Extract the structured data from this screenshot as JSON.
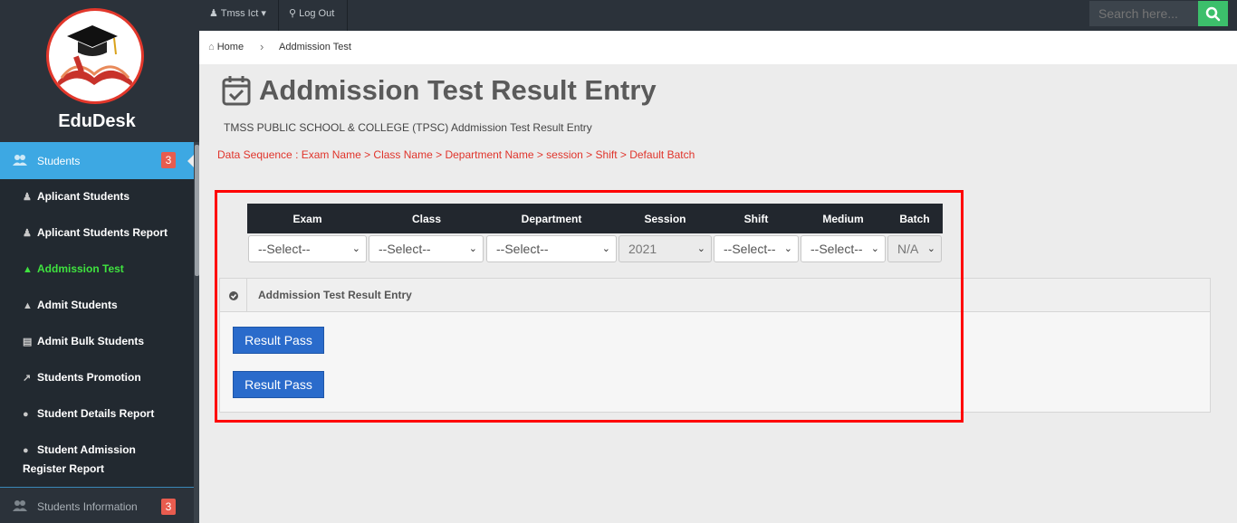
{
  "sidebar": {
    "brand": "EduDesk",
    "logo_icon": "graduation-book-logo",
    "active": {
      "label": "Students",
      "badge": "3",
      "icon": "users-icon"
    },
    "items": [
      {
        "label": "Aplicant Students",
        "icon": "user-add-icon",
        "green": false
      },
      {
        "label": "Aplicant Students Report",
        "icon": "user-add-icon",
        "green": false
      },
      {
        "label": "Addmission Test",
        "icon": "graduation-cap-icon",
        "green": true
      },
      {
        "label": "Admit Students",
        "icon": "graduation-cap-icon",
        "green": false
      },
      {
        "label": "Admit Bulk Students",
        "icon": "id-card-icon",
        "green": false
      },
      {
        "label": "Students Promotion",
        "icon": "line-chart-icon",
        "green": false
      },
      {
        "label": "Student Details Report",
        "icon": "circle-icon",
        "green": false
      },
      {
        "label": "Student Admission Register Report",
        "icon": "circle-icon",
        "green": false
      }
    ],
    "bottom": {
      "label": "Students Information",
      "badge": "3",
      "icon": "users-icon"
    }
  },
  "topbar": {
    "user": "Tmss Ict",
    "logout": "Log Out",
    "search_placeholder": "Search here..."
  },
  "breadcrumb": {
    "home": "Home",
    "current": "Addmission Test"
  },
  "page": {
    "title": "Addmission Test Result Entry",
    "subtitle": "TMSS PUBLIC SCHOOL & COLLEGE (TPSC) Addmission Test Result Entry",
    "sequence": "Data Sequence : Exam Name > Class Name > Department Name > session > Shift > Default Batch"
  },
  "filters": {
    "headers": {
      "exam": "Exam",
      "class": "Class",
      "department": "Department",
      "session": "Session",
      "shift": "Shift",
      "medium": "Medium",
      "batch": "Batch"
    },
    "values": {
      "exam": "--Select--",
      "class": "--Select--",
      "department": "--Select--",
      "session": "2021",
      "shift": "--Select--",
      "medium": "--Select--",
      "batch": "N/A"
    }
  },
  "entry": {
    "header": "Addmission Test Result Entry",
    "buttons": [
      "Result Pass",
      "Result Pass"
    ]
  },
  "colors": {
    "accent": "#3da8e3",
    "highlight_box": "#ff0000",
    "button": "#2a6bcb",
    "active_green": "#3fe33f"
  }
}
